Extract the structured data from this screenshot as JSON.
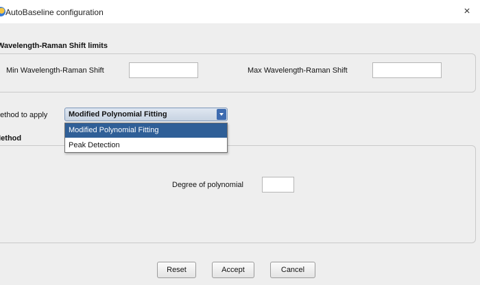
{
  "window": {
    "title": "AutoBaseline configuration",
    "close_glyph": "×"
  },
  "limits": {
    "section_title": "Wavelength-Raman Shift limits",
    "min_label": "Min Wavelength-Raman Shift",
    "min_value": "",
    "max_label": "Max Wavelength-Raman Shift",
    "max_value": ""
  },
  "method_select": {
    "label": "Method to apply",
    "selected": "Modified Polynomial Fitting",
    "options": [
      "Modified Polynomial Fitting",
      "Peak Detection"
    ]
  },
  "method_panel": {
    "section_title": "Method",
    "degree_label": "Degree of polynomial",
    "degree_value": ""
  },
  "buttons": {
    "reset": "Reset",
    "accept": "Accept",
    "cancel": "Cancel"
  },
  "colors": {
    "selection": "#2f5f97",
    "combo_arrow": "#3d6bb0"
  },
  "icons": {
    "app": "app-logo-icon",
    "close": "close-icon",
    "dropdown": "chevron-down-icon"
  }
}
